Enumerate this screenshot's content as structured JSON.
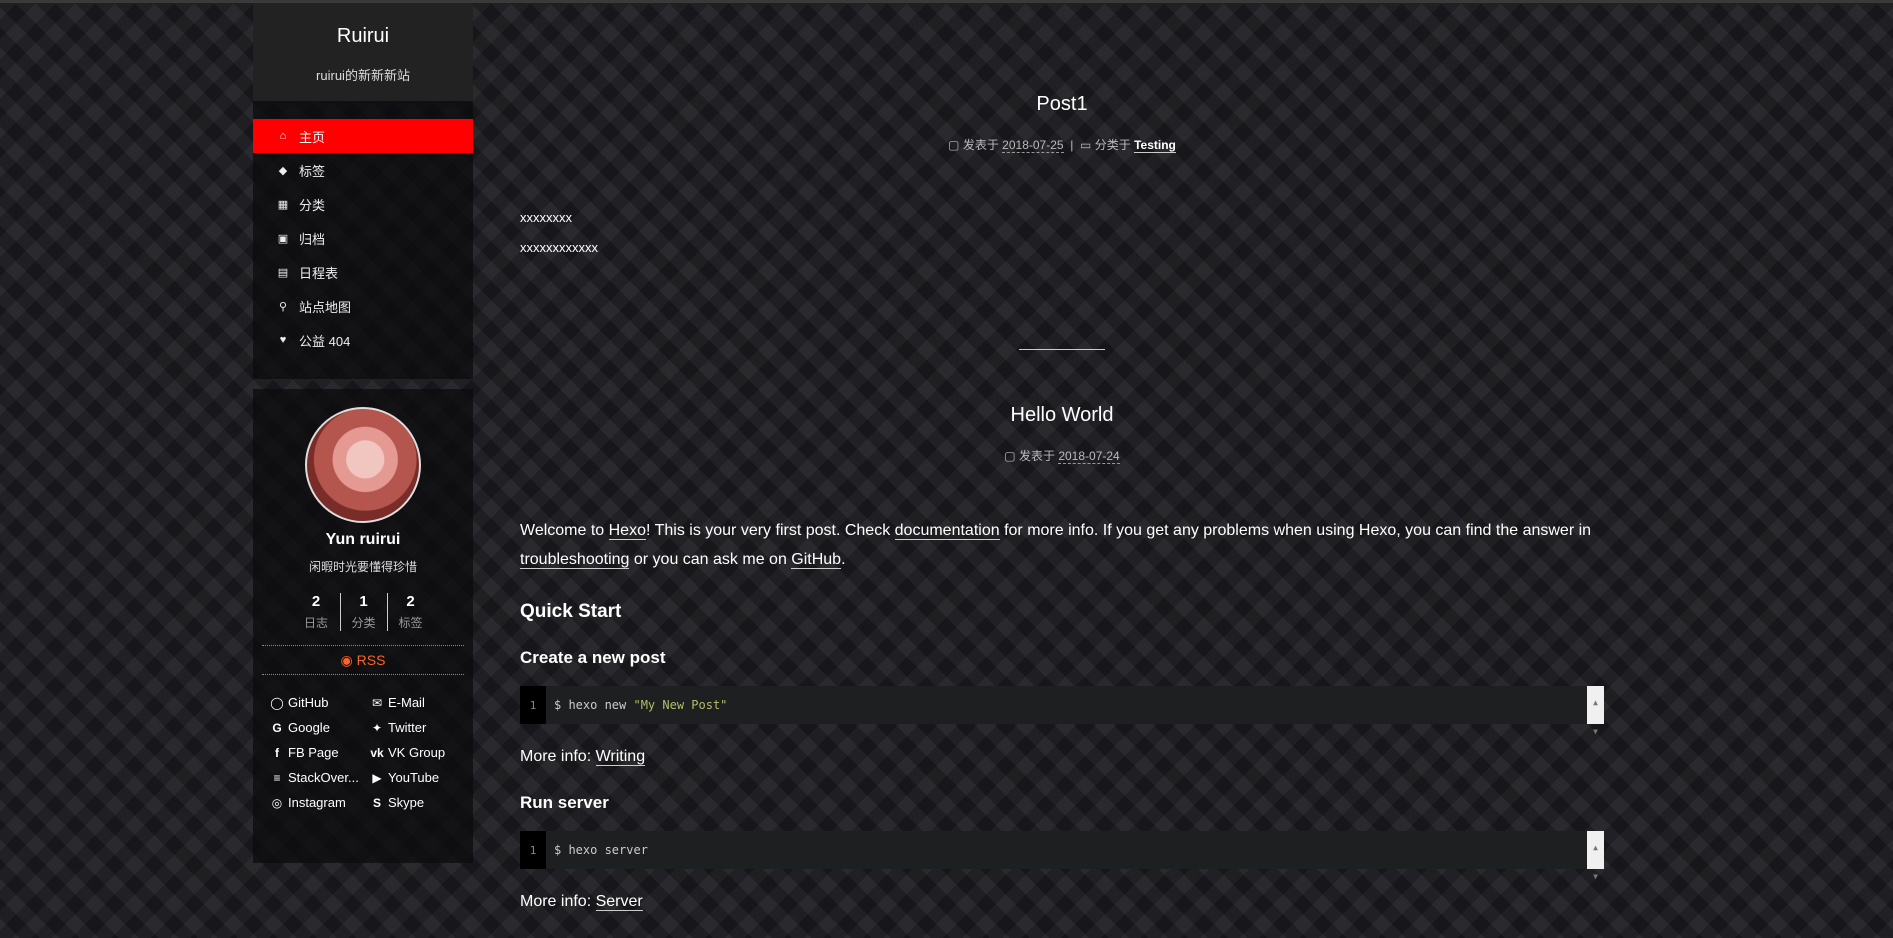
{
  "site": {
    "title": "Ruirui",
    "subtitle": "ruirui的新新新站"
  },
  "menu": [
    {
      "label": "主页",
      "icon": "home-icon",
      "glyph": "⌂"
    },
    {
      "label": "标签",
      "icon": "tags-icon",
      "glyph": "◆"
    },
    {
      "label": "分类",
      "icon": "th-icon",
      "glyph": "▦"
    },
    {
      "label": "归档",
      "icon": "archive-icon",
      "glyph": "▣"
    },
    {
      "label": "日程表",
      "icon": "calendar-icon",
      "glyph": "▤"
    },
    {
      "label": "站点地图",
      "icon": "sitemap-icon",
      "glyph": "⚲"
    },
    {
      "label": "公益 404",
      "icon": "heartbeat-icon",
      "glyph": "♥"
    }
  ],
  "author": {
    "name": "Yun ruirui",
    "description": "闲暇时光要懂得珍惜",
    "stats": [
      {
        "count": "2",
        "label": "日志"
      },
      {
        "count": "1",
        "label": "分类"
      },
      {
        "count": "2",
        "label": "标签"
      }
    ],
    "rss": "RSS",
    "rss_glyph": "◉",
    "links": [
      {
        "label": "GitHub",
        "icon": "github-icon",
        "glyph": "◯"
      },
      {
        "label": "E-Mail",
        "icon": "envelope-icon",
        "glyph": "✉"
      },
      {
        "label": "Google",
        "icon": "google-icon",
        "glyph": "G"
      },
      {
        "label": "Twitter",
        "icon": "twitter-icon",
        "glyph": "✦"
      },
      {
        "label": "FB Page",
        "icon": "facebook-icon",
        "glyph": "f"
      },
      {
        "label": "VK Group",
        "icon": "vk-icon",
        "glyph": "vk"
      },
      {
        "label": "StackOver...",
        "icon": "stack-overflow-icon",
        "glyph": "≡"
      },
      {
        "label": "YouTube",
        "icon": "youtube-icon",
        "glyph": "▶"
      },
      {
        "label": "Instagram",
        "icon": "instagram-icon",
        "glyph": "◎"
      },
      {
        "label": "Skype",
        "icon": "skype-icon",
        "glyph": "S"
      }
    ]
  },
  "posts": [
    {
      "title": "Post1",
      "posted_label": "发表于",
      "date": "2018-07-25",
      "sep": "|",
      "category_label": "分类于",
      "category": "Testing",
      "lines": [
        "xxxxxxxx",
        "xxxxxxxxxxxx"
      ]
    },
    {
      "title": "Hello World",
      "posted_label": "发表于",
      "date": "2018-07-24",
      "intro": {
        "t1": "Welcome to ",
        "hexo": "Hexo",
        "t2": "! This is your very first post. Check ",
        "documentation": "documentation",
        "t3": " for more info. If you get any problems when using Hexo, you can find the answer in ",
        "troubleshooting": "troubleshooting",
        "t4": " or you can ask me on ",
        "github": "GitHub",
        "t5": "."
      },
      "quick_start": "Quick Start",
      "sections": [
        {
          "heading": "Create a new post",
          "line_no": "1",
          "cmd": "$ hexo new ",
          "cmd_str": "\"My New Post\"",
          "more_label": "More info: ",
          "more_link": "Writing"
        },
        {
          "heading": "Run server",
          "line_no": "1",
          "cmd": "$ hexo server",
          "cmd_str": "",
          "more_label": "More info: ",
          "more_link": "Server"
        }
      ]
    }
  ],
  "colors": {
    "accent": "#ff0000",
    "rss": "#fc6423",
    "sidebar_bg": "#222222"
  },
  "scroll_glyphs": {
    "up": "▲",
    "down": "▼"
  }
}
